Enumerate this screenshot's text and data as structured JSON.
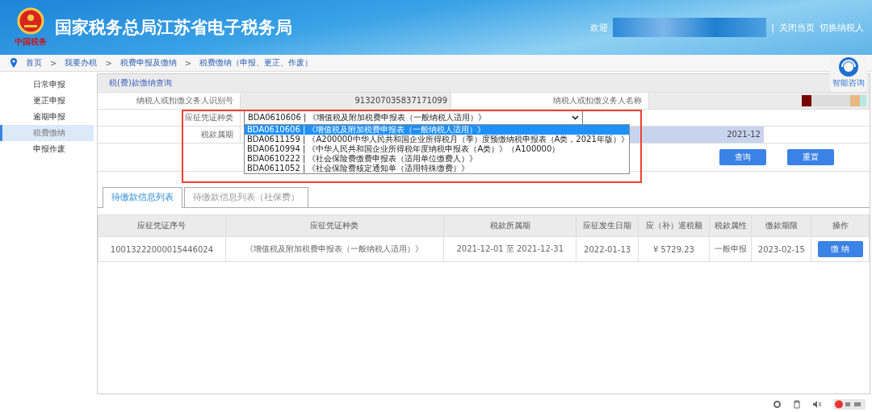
{
  "header": {
    "logo_caption": "中国税务",
    "title": "国家税务总局江苏省电子税务局",
    "welcome": "欢迎",
    "separator": "|",
    "links": [
      "关闭当页",
      "切换纳税人"
    ]
  },
  "breadcrumb": {
    "separator": ">",
    "items": [
      "首页",
      "我要办税",
      "税费申报及缴纳",
      "税费缴纳（申报、更正、作废）"
    ]
  },
  "consult": {
    "label": "智能咨询"
  },
  "sidebar": {
    "items": [
      {
        "label": "日常申报",
        "selected": false
      },
      {
        "label": "更正申报",
        "selected": false
      },
      {
        "label": "逾期申报",
        "selected": false
      },
      {
        "label": "税费缴纳",
        "selected": true
      },
      {
        "label": "申报作废",
        "selected": false
      }
    ]
  },
  "query": {
    "title": "税(费)款缴纳查询",
    "taxpayer_id_label": "纳税人或扣缴义务人识别号",
    "taxpayer_id": "913207035837171099",
    "taxpayer_name_label": "纳税人或扣缴义务人名称",
    "voucher_type_label": "应征凭证种类",
    "voucher_type_value": "BDA0610606 | 《增值税及附加税费申报表（一般纳税人适用）》",
    "period_label": "税款属期",
    "period_value": "2021-12",
    "options": [
      {
        "label": "BDA0610606 | 《增值税及附加税费申报表（一般纳税人适用）》",
        "selected": true
      },
      {
        "label": "BDA0611159 | 《A200000中华人民共和国企业所得税月（季）度预缴纳税申报表（A类，2021年版）》",
        "selected": false
      },
      {
        "label": "BDA0610994 | 《中华人民共和国企业所得税年度纳税申报表（A类）》（A100000）",
        "selected": false
      },
      {
        "label": "BDA0610222 | 《社会保险费缴费申报表（适用单位缴费人）》",
        "selected": false
      },
      {
        "label": "BDA0611052 | 《社会保险费核定通知单（适用特殊缴费）》",
        "selected": false
      }
    ],
    "buttons": [
      "查询",
      "重置"
    ]
  },
  "tabs": [
    {
      "label": "待缴款信息列表",
      "selected": true
    },
    {
      "label": "待缴款信息列表（社保费）",
      "selected": false
    }
  ],
  "table": {
    "columns": [
      "应征凭证序号",
      "应征凭证种类",
      "税款所属期",
      "应征发生日期",
      "应（补）退税额",
      "税款属性",
      "缴款期限",
      "操作"
    ],
    "rows": [
      {
        "cells": [
          "10013222000015446024",
          "《增值税及附加税费申报表（一般纳税人适用）》",
          "2021-12-01 至 2021-12-31",
          "2022-01-13",
          "¥ 5729.23",
          "一般申报",
          "2023-02-15"
        ],
        "action": "缴 纳"
      }
    ]
  }
}
